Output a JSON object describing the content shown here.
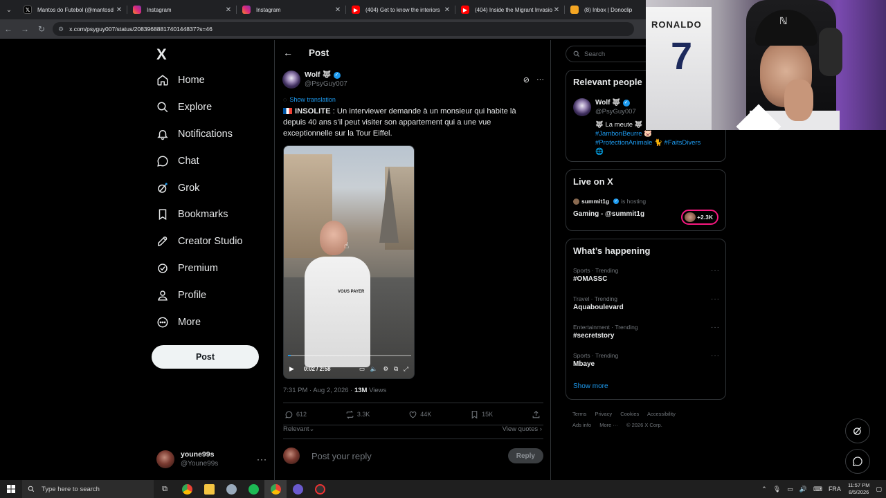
{
  "browser": {
    "tabs": [
      {
        "title": "Mantos do Futebol (@mantosd",
        "favicon": "x-logo-icon"
      },
      {
        "title": "Instagram",
        "favicon": "instagram-icon"
      },
      {
        "title": "Instagram",
        "favicon": "instagram-icon"
      },
      {
        "title": "(404) Get to know the interiors",
        "favicon": "youtube-icon"
      },
      {
        "title": "(404) Inside the Migrant Invasio",
        "favicon": "youtube-icon"
      },
      {
        "title": "(8) Inbox | Donoclip",
        "favicon": "mail-icon"
      }
    ],
    "url": "x.com/psyguy007/status/2083968881740144837?s=46"
  },
  "nav": {
    "logo": "X",
    "items": [
      {
        "label": "Home",
        "icon": "home-icon"
      },
      {
        "label": "Explore",
        "icon": "search-icon"
      },
      {
        "label": "Notifications",
        "icon": "bell-icon"
      },
      {
        "label": "Chat",
        "icon": "chat-icon"
      },
      {
        "label": "Grok",
        "icon": "grok-icon"
      },
      {
        "label": "Bookmarks",
        "icon": "bookmark-icon"
      },
      {
        "label": "Creator Studio",
        "icon": "rocket-icon"
      },
      {
        "label": "Premium",
        "icon": "verified-icon"
      },
      {
        "label": "Profile",
        "icon": "person-icon"
      },
      {
        "label": "More",
        "icon": "more-circle-icon"
      }
    ],
    "post_label": "Post",
    "account": {
      "name": "youne99s",
      "handle": "@Youne99s"
    }
  },
  "post": {
    "header_title": "Post",
    "author_name": "Wolf 🐺",
    "author_handle": "@PsyGuy007",
    "show_translation": "Show translation",
    "text_bold": "INSOLITE",
    "text_rest": " : Un interviewer demande à un monsieur qui habite là depuis 40 ans s’il peut visiter son appartement qui a une vue exceptionnelle sur la Tour Eiffel.",
    "video": {
      "time": "0:02 / 2:58",
      "shirt_text": "VOUS PAYER",
      "progress": 0.02
    },
    "meta_time": "7:31 PM · Aug 2, 2026 · ",
    "meta_views": "13M",
    "meta_views_label": " Views",
    "counts": {
      "replies": "612",
      "reposts": "3.3K",
      "likes": "44K",
      "bookmarks": "15K"
    },
    "relevant_label": "Relevant",
    "view_quotes": "View quotes",
    "reply_placeholder": "Post your reply",
    "reply_button": "Reply"
  },
  "sidebar": {
    "search_placeholder": "Search",
    "relevant": {
      "title": "Relevant people",
      "name": "Wolf 🐺",
      "handle": "@PsyGuy007",
      "bio_start": "🐺 La meute 🐺",
      "tags": [
        "#JambonBeurre",
        "#ProtectionAnimale",
        "#FaitsDivers"
      ]
    },
    "live": {
      "title": "Live on X",
      "host": "summit1g",
      "host_suffix": "is hosting",
      "stream_title": "Gaming - @summit1g",
      "count": "+2.3K"
    },
    "happening": {
      "title": "What’s happening",
      "trends": [
        {
          "category": "Sports · Trending",
          "topic": "#OMASSC"
        },
        {
          "category": "Travel · Trending",
          "topic": "Aquaboulevard"
        },
        {
          "category": "Entertainment · Trending",
          "topic": "#secretstory"
        },
        {
          "category": "Sports · Trending",
          "topic": "Mbaye"
        }
      ],
      "show_more": "Show more"
    },
    "footer": [
      "Terms",
      "Privacy",
      "Cookies",
      "Accessibility",
      "Ads info",
      "More ···",
      "© 2026 X Corp."
    ]
  },
  "webcam": {
    "jersey_name": "RONALDO",
    "jersey_number": "7"
  },
  "taskbar": {
    "search_placeholder": "Type here to search",
    "language": "FRA",
    "time": "11:57 PM",
    "date": "8/5/2026"
  },
  "colors": {
    "accent": "#1d9bf0",
    "background": "#000000",
    "border": "#2f3336",
    "muted": "#71767b"
  }
}
